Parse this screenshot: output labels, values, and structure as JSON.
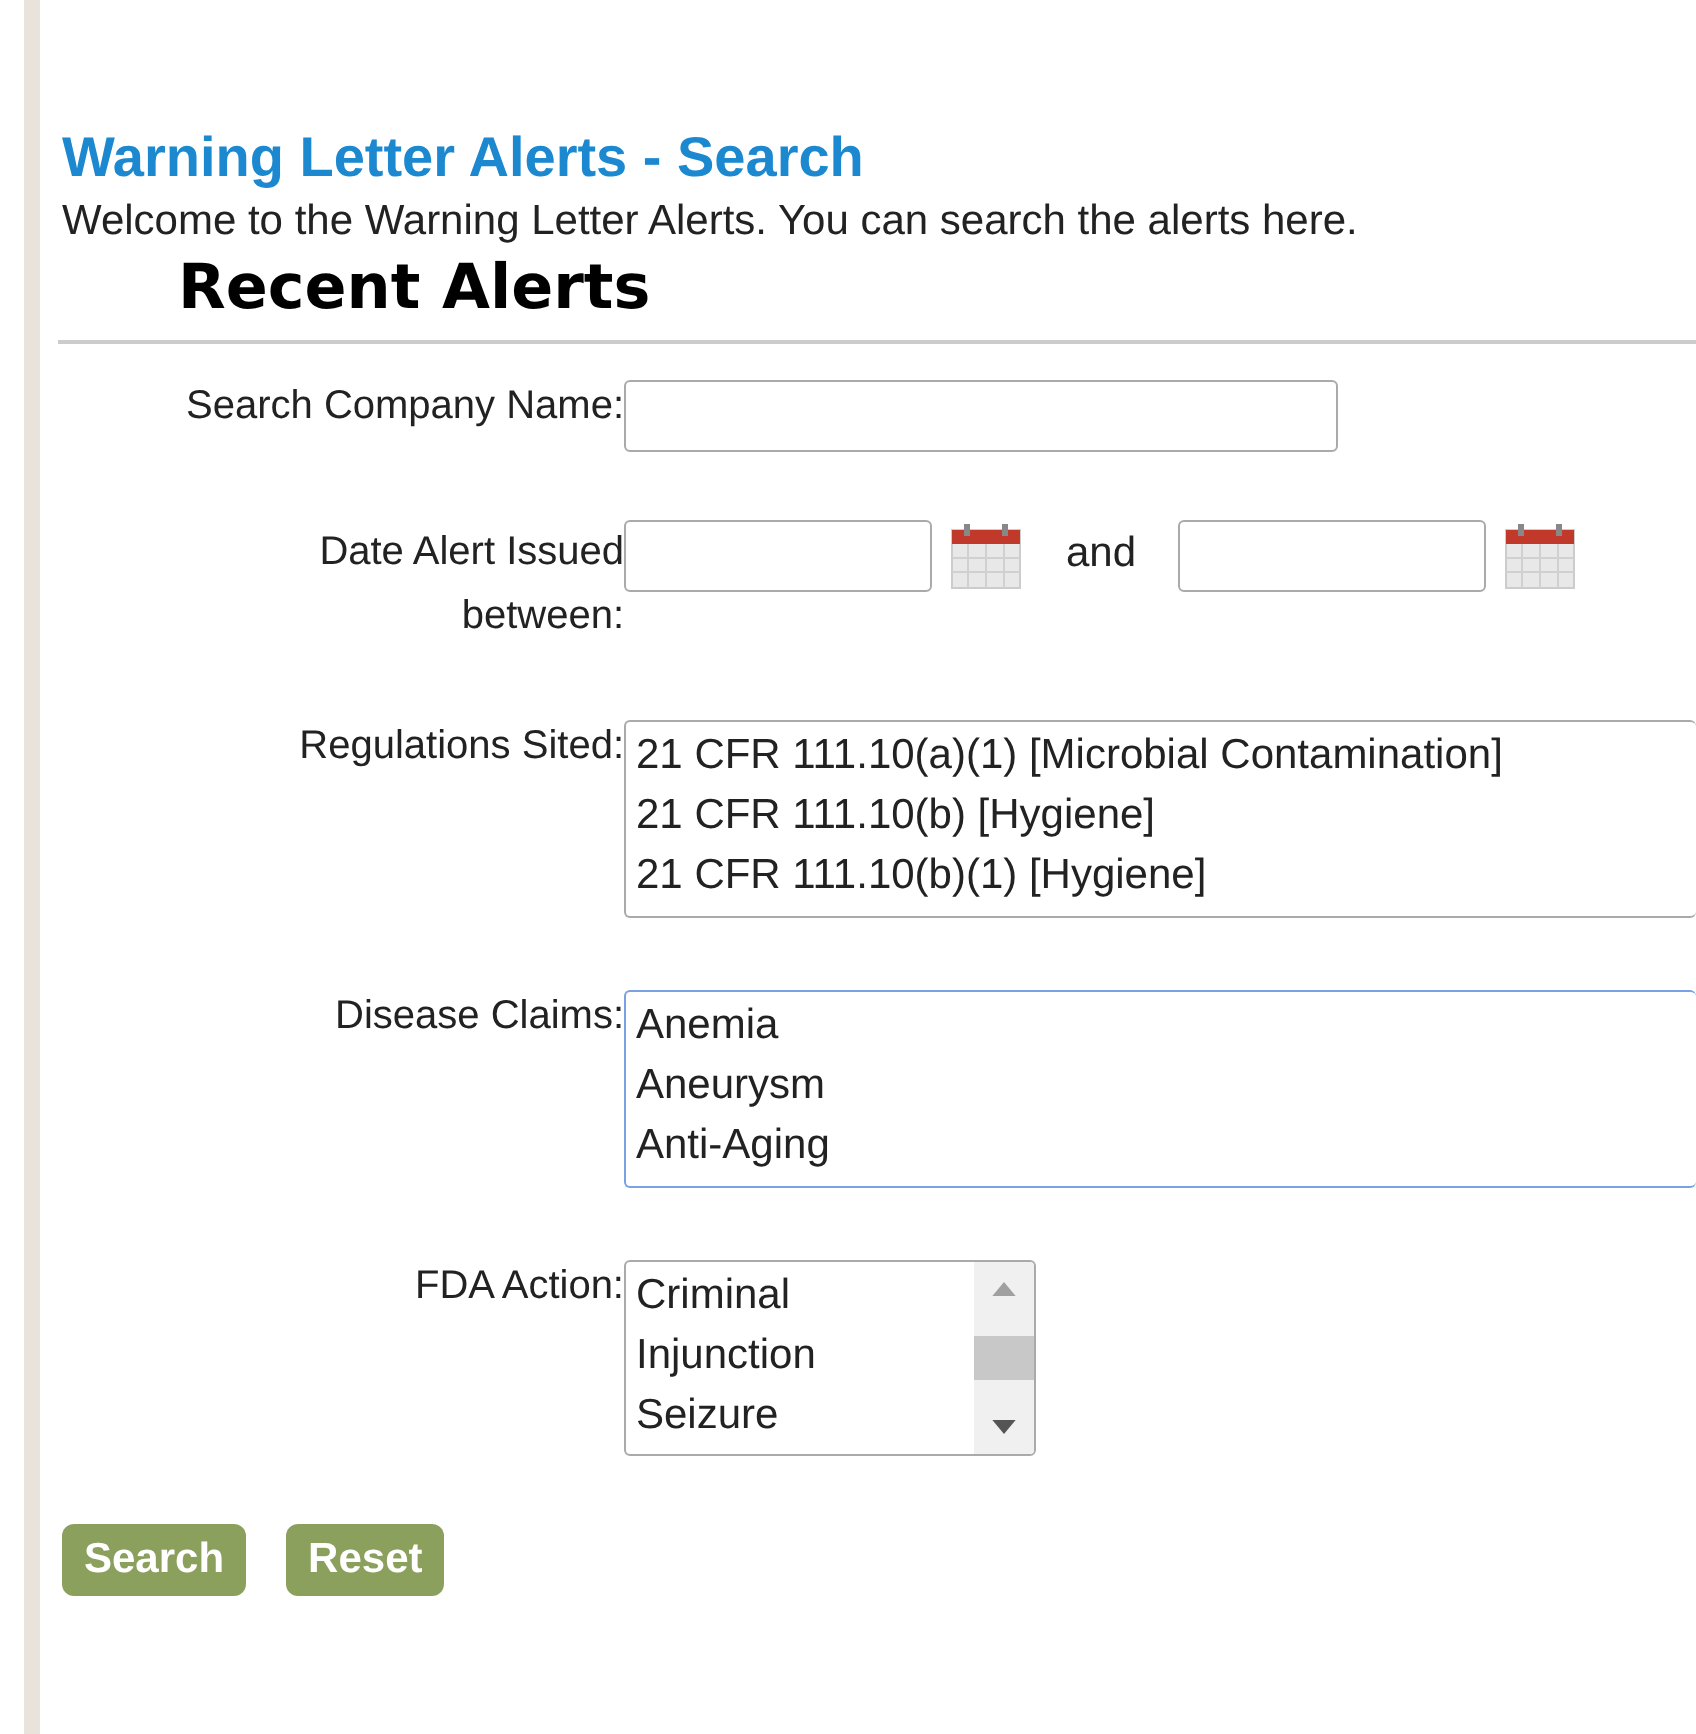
{
  "title": "Warning Letter Alerts - Search",
  "intro": "Welcome to the Warning Letter Alerts. You can search the alerts here.",
  "section_heading": "Recent Alerts",
  "company": {
    "label": "Search Company Name:"
  },
  "date_range": {
    "label": "Date Alert Issued between:",
    "joiner": "and"
  },
  "lists": [
    {
      "label": "Regulations Sited:",
      "focused": false,
      "scrollbar": false,
      "kind": "wide",
      "options": [
        "21 CFR 111.10(a)(1) [Microbial Contamination]",
        "21 CFR 111.10(b) [Hygiene]",
        "21 CFR 111.10(b)(1) [Hygiene]"
      ]
    },
    {
      "label": "Disease Claims:",
      "focused": true,
      "scrollbar": false,
      "kind": "wide",
      "options": [
        "Anemia",
        "Aneurysm",
        "Anti-Aging"
      ]
    },
    {
      "label": "FDA Action:",
      "focused": false,
      "scrollbar": true,
      "kind": "narrow",
      "options": [
        "Criminal",
        "Injunction",
        "Seizure"
      ]
    }
  ],
  "buttons": [
    "Search",
    "Reset"
  ]
}
